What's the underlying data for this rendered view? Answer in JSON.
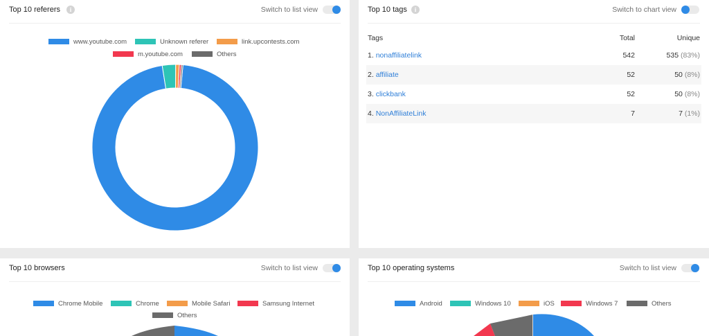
{
  "referers": {
    "title": "Top 10 referers",
    "switch_label": "Switch to list view",
    "legend": [
      {
        "label": "www.youtube.com",
        "color": "#2f8be6"
      },
      {
        "label": "Unknown referer",
        "color": "#2ec4b6"
      },
      {
        "label": "link.upcontests.com",
        "color": "#f39c4a"
      },
      {
        "label": "m.youtube.com",
        "color": "#f2384f"
      },
      {
        "label": "Others",
        "color": "#6b6b6b"
      }
    ],
    "chart_data": {
      "type": "pie",
      "donut": true,
      "slices": [
        {
          "label": "www.youtube.com",
          "value": 96.0
        },
        {
          "label": "Unknown referer",
          "value": 2.6
        },
        {
          "label": "link.upcontests.com",
          "value": 0.7
        },
        {
          "label": "m.youtube.com",
          "value": 0.4
        },
        {
          "label": "Others",
          "value": 0.3
        }
      ]
    }
  },
  "tags": {
    "title": "Top 10 tags",
    "switch_label": "Switch to chart view",
    "columns": [
      "Tags",
      "Total",
      "Unique"
    ],
    "rows": [
      {
        "index": "1.",
        "name": "nonaffiliatelink",
        "total": "542",
        "unique": "535",
        "pct": "(83%)"
      },
      {
        "index": "2.",
        "name": "affiliate",
        "total": "52",
        "unique": "50",
        "pct": "(8%)"
      },
      {
        "index": "3.",
        "name": "clickbank",
        "total": "52",
        "unique": "50",
        "pct": "(8%)"
      },
      {
        "index": "4.",
        "name": "NonAffiliateLink",
        "total": "7",
        "unique": "7",
        "pct": "(1%)"
      }
    ]
  },
  "browsers": {
    "title": "Top 10 browsers",
    "switch_label": "Switch to list view",
    "legend": [
      {
        "label": "Chrome Mobile",
        "color": "#2f8be6"
      },
      {
        "label": "Chrome",
        "color": "#2ec4b6"
      },
      {
        "label": "Mobile Safari",
        "color": "#f39c4a"
      },
      {
        "label": "Samsung Internet",
        "color": "#f2384f"
      },
      {
        "label": "Others",
        "color": "#6b6b6b"
      }
    ]
  },
  "os": {
    "title": "Top 10 operating systems",
    "switch_label": "Switch to list view",
    "legend": [
      {
        "label": "Android",
        "color": "#2f8be6"
      },
      {
        "label": "Windows 10",
        "color": "#2ec4b6"
      },
      {
        "label": "iOS",
        "color": "#f39c4a"
      },
      {
        "label": "Windows 7",
        "color": "#f2384f"
      },
      {
        "label": "Others",
        "color": "#6b6b6b"
      }
    ]
  }
}
